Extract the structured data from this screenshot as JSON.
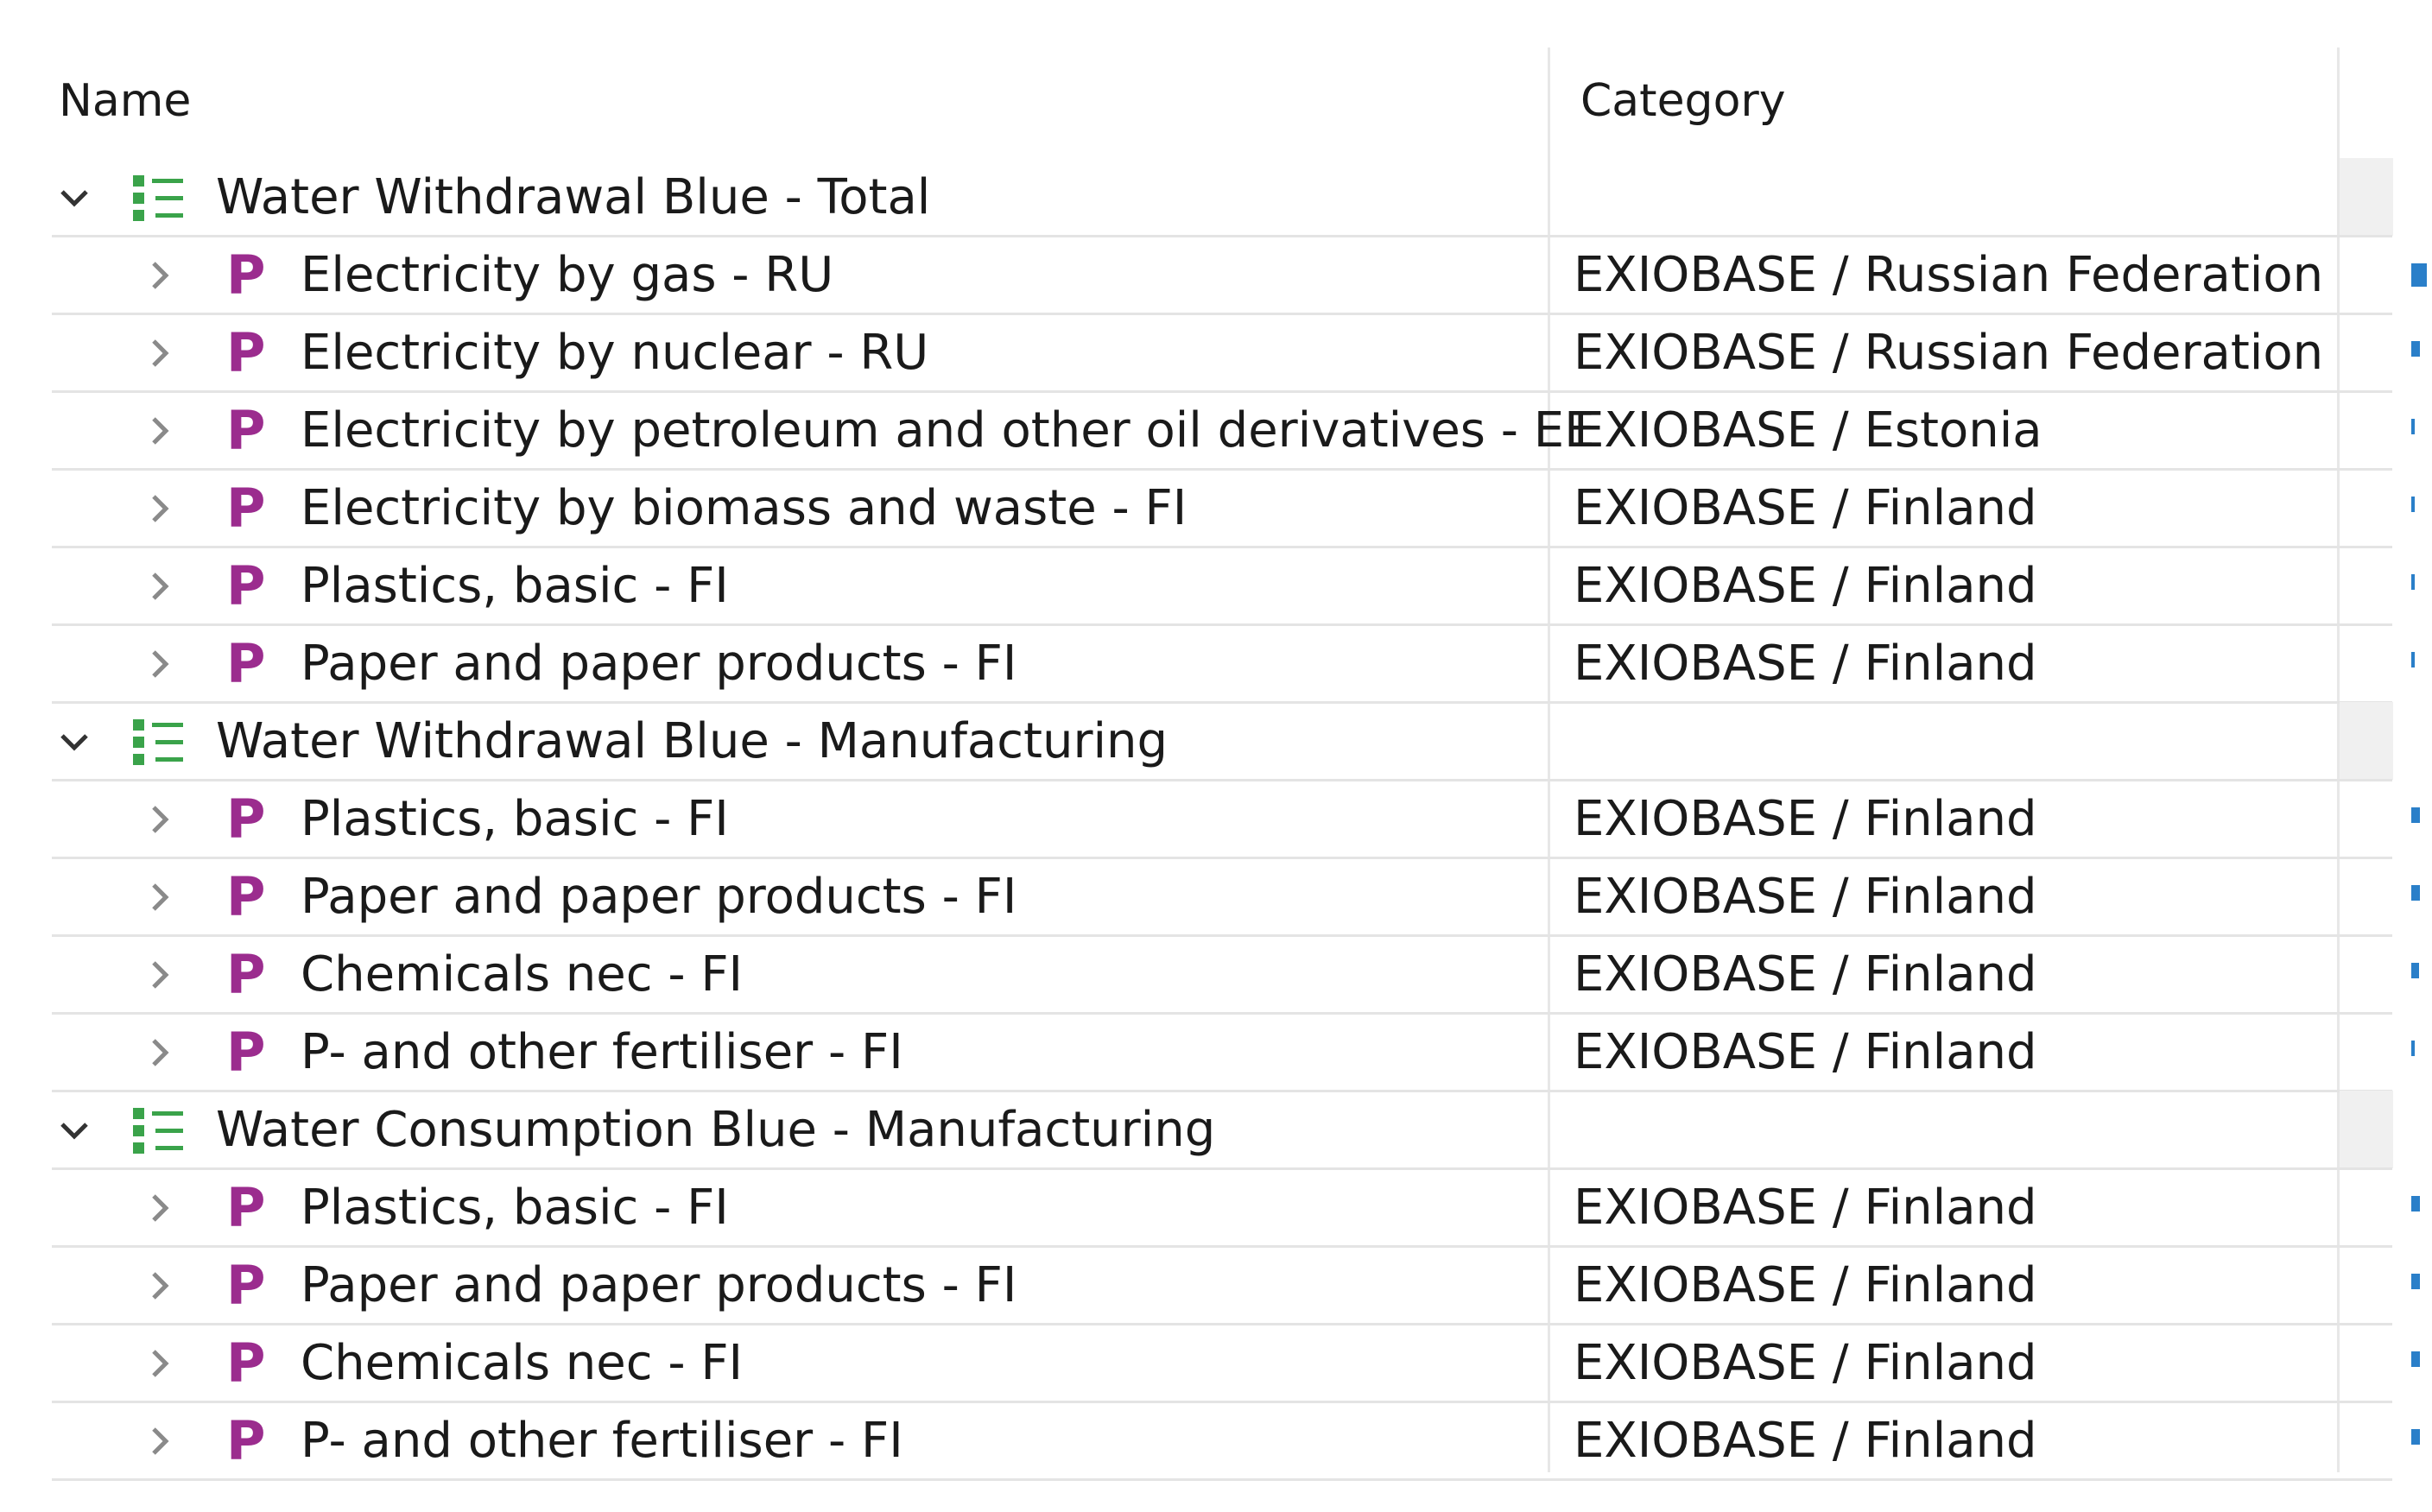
{
  "headers": {
    "name": "Name",
    "category": "Category"
  },
  "colors": {
    "process_icon": "#9b2c8e",
    "group_icon": "#3aa34a",
    "bar": "#2a7fc9"
  },
  "groups": [
    {
      "label": "Water Withdrawal Blue - Total",
      "expanded": true,
      "icon": "list-icon",
      "items": [
        {
          "label": "Electricity by gas - RU",
          "category": "EXIOBASE / Russian Federation",
          "icon": "P",
          "share": 0.9
        },
        {
          "label": "Electricity by nuclear - RU",
          "category": "EXIOBASE / Russian Federation",
          "icon": "P",
          "share": 0.5
        },
        {
          "label": "Electricity by petroleum and other oil derivatives - EE",
          "category": "EXIOBASE / Estonia",
          "icon": "P",
          "share": 0.2
        },
        {
          "label": "Electricity by biomass and waste - FI",
          "category": "EXIOBASE / Finland",
          "icon": "P",
          "share": 0.15
        },
        {
          "label": "Plastics, basic - FI",
          "category": "EXIOBASE / Finland",
          "icon": "P",
          "share": 0.15
        },
        {
          "label": "Paper and paper products - FI",
          "category": "EXIOBASE / Finland",
          "icon": "P",
          "share": 0.1
        }
      ]
    },
    {
      "label": "Water Withdrawal Blue - Manufacturing",
      "expanded": true,
      "icon": "list-icon",
      "items": [
        {
          "label": "Plastics, basic - FI",
          "category": "EXIOBASE / Finland",
          "icon": "P",
          "share": 0.5
        },
        {
          "label": "Paper and paper products - FI",
          "category": "EXIOBASE / Finland",
          "icon": "P",
          "share": 0.5
        },
        {
          "label": "Chemicals nec - FI",
          "category": "EXIOBASE / Finland",
          "icon": "P",
          "share": 0.45
        },
        {
          "label": "P- and other fertiliser - FI",
          "category": "EXIOBASE / Finland",
          "icon": "P",
          "share": 0.2
        }
      ]
    },
    {
      "label": "Water Consumption Blue - Manufacturing",
      "expanded": true,
      "icon": "list-icon",
      "items": [
        {
          "label": "Plastics, basic - FI",
          "category": "EXIOBASE / Finland",
          "icon": "P",
          "share": 0.5
        },
        {
          "label": "Paper and paper products - FI",
          "category": "EXIOBASE / Finland",
          "icon": "P",
          "share": 0.5
        },
        {
          "label": "Chemicals nec - FI",
          "category": "EXIOBASE / Finland",
          "icon": "P",
          "share": 0.5
        },
        {
          "label": "P- and other fertiliser - FI",
          "category": "EXIOBASE / Finland",
          "icon": "P",
          "share": 0.5
        }
      ]
    }
  ]
}
